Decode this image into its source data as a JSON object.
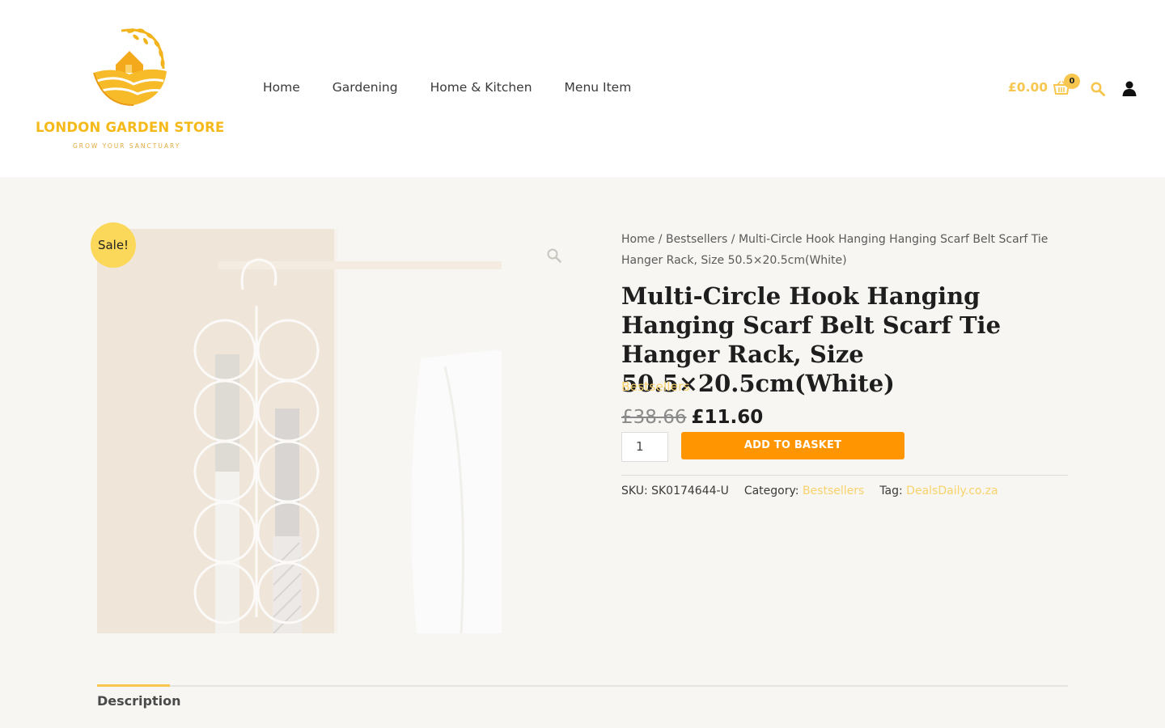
{
  "brand": {
    "name": "LONDON GARDEN STORE",
    "tagline": "GROW YOUR SANCTUARY"
  },
  "nav": {
    "items": [
      "Home",
      "Gardening",
      "Home & Kitchen",
      "Menu Item"
    ]
  },
  "header_actions": {
    "cart_total": "£0.00",
    "cart_count": "0",
    "cart_icon": "basket-icon",
    "search_icon": "search-icon",
    "account_icon": "user-icon"
  },
  "product": {
    "sale_badge": "Sale!",
    "breadcrumb": {
      "home": "Home",
      "sep1": " / ",
      "category": "Bestsellers",
      "sep2": " / ",
      "current": "Multi-Circle Hook Hanging Hanging Scarf Belt Scarf Tie Hanger Rack, Size 50.5×20.5cm(White)"
    },
    "title": "Multi-Circle Hook Hanging Hanging Scarf Belt Scarf Tie Hanger Rack, Size 50.5×20.5cm(White)",
    "category_link": "Bestsellers",
    "price_old": "£38.66",
    "price_new": "£11.60",
    "quantity": "1",
    "add_to_basket": "ADD TO BASKET",
    "meta": {
      "sku_label": "SKU:",
      "sku": "SK0174644-U",
      "category_label": "Category:",
      "category": "Bestsellers",
      "tag_label": "Tag:",
      "tag": "DealsDaily.co.za"
    }
  },
  "tabs": {
    "description": "Description"
  },
  "colors": {
    "accent": "#f6c64f",
    "button": "#ff9500",
    "background": "#f7f6f2"
  }
}
